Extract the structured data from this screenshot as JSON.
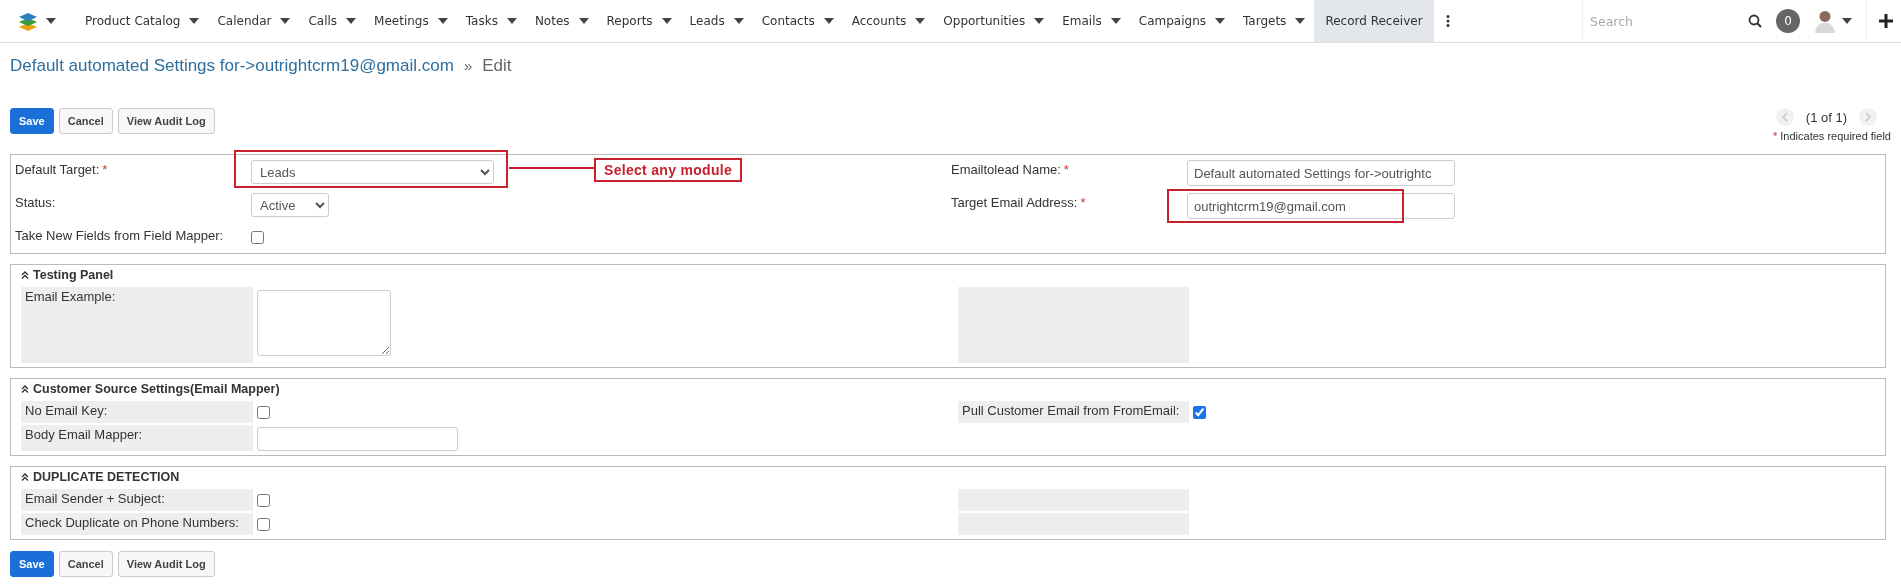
{
  "nav": {
    "menu_caret": true,
    "items": [
      {
        "label": "Product Catalog",
        "dropdown": true,
        "selected": false
      },
      {
        "label": "Calendar",
        "dropdown": true,
        "selected": false
      },
      {
        "label": "Calls",
        "dropdown": true,
        "selected": false
      },
      {
        "label": "Meetings",
        "dropdown": true,
        "selected": false
      },
      {
        "label": "Tasks",
        "dropdown": true,
        "selected": false
      },
      {
        "label": "Notes",
        "dropdown": true,
        "selected": false
      },
      {
        "label": "Reports",
        "dropdown": true,
        "selected": false
      },
      {
        "label": "Leads",
        "dropdown": true,
        "selected": false
      },
      {
        "label": "Contacts",
        "dropdown": true,
        "selected": false
      },
      {
        "label": "Accounts",
        "dropdown": true,
        "selected": false
      },
      {
        "label": "Opportunities",
        "dropdown": true,
        "selected": false
      },
      {
        "label": "Emails",
        "dropdown": true,
        "selected": false
      },
      {
        "label": "Campaigns",
        "dropdown": true,
        "selected": false
      },
      {
        "label": "Targets",
        "dropdown": true,
        "selected": false
      },
      {
        "label": "Record Receiver",
        "dropdown": false,
        "selected": true
      }
    ],
    "search": {
      "placeholder": "Search"
    },
    "notifications": "0"
  },
  "header": {
    "title": "Default automated Settings for->outrightcrm19@gmail.com",
    "separator": "»",
    "breadcrumb": "Edit"
  },
  "top_buttons": [
    {
      "label": "Save",
      "kind": "primary"
    },
    {
      "label": "Cancel",
      "kind": "default"
    },
    {
      "label": "View Audit Log",
      "kind": "default"
    }
  ],
  "pagination": {
    "text": "(1 of 1)",
    "prev_disabled": true,
    "next_disabled": true
  },
  "required_note": {
    "mark": "*",
    "text": "Indicates required field"
  },
  "main_panel": {
    "rows": [
      {
        "left": {
          "label": "Default Target:",
          "required": true,
          "kind": "select",
          "value": "Leads",
          "highlighted": true,
          "callout": "Select any module"
        },
        "right": {
          "label": "Emailtolead Name:",
          "required": true,
          "kind": "text",
          "value": "Default automated Settings for->outrightc",
          "highlighted": false
        }
      },
      {
        "left": {
          "label": "Status:",
          "required": false,
          "kind": "select",
          "value": "Active",
          "highlighted": false
        },
        "right": {
          "label": "Target Email Address:",
          "required": true,
          "kind": "text",
          "value": "outrightcrm19@gmail.com",
          "highlighted": true
        }
      },
      {
        "left": {
          "label": "Take New Fields from Field Mapper:",
          "required": false,
          "kind": "checkbox",
          "checked": false,
          "highlighted": false
        }
      }
    ]
  },
  "panels": [
    {
      "title": "Testing Panel",
      "expanded": true,
      "rows": [
        {
          "left": {
            "label": "Email Example:",
            "kind": "textarea"
          },
          "right": {
            "kind": "blank"
          }
        }
      ]
    },
    {
      "title": "Customer Source Settings(Email Mapper)",
      "expanded": true,
      "rows": [
        {
          "left": {
            "label": "No Email Key:",
            "kind": "checkbox",
            "checked": false
          },
          "right": {
            "label": "Pull Customer Email from FromEmail:",
            "kind": "checkbox",
            "checked": true
          }
        },
        {
          "left": {
            "label": "Body Email Mapper:",
            "kind": "text"
          }
        }
      ]
    },
    {
      "title": "DUPLICATE DETECTION",
      "expanded": true,
      "rows": [
        {
          "left": {
            "label": "Email Sender + Subject:",
            "kind": "checkbox",
            "checked": false
          },
          "right": {
            "kind": "blank"
          }
        },
        {
          "left": {
            "label": "Check Duplicate on Phone Numbers:",
            "kind": "checkbox",
            "checked": false
          },
          "right": {
            "kind": "blank"
          }
        }
      ]
    }
  ],
  "bottom_buttons": [
    {
      "label": "Save",
      "kind": "primary"
    },
    {
      "label": "Cancel",
      "kind": "default"
    },
    {
      "label": "View Audit Log",
      "kind": "default"
    }
  ]
}
